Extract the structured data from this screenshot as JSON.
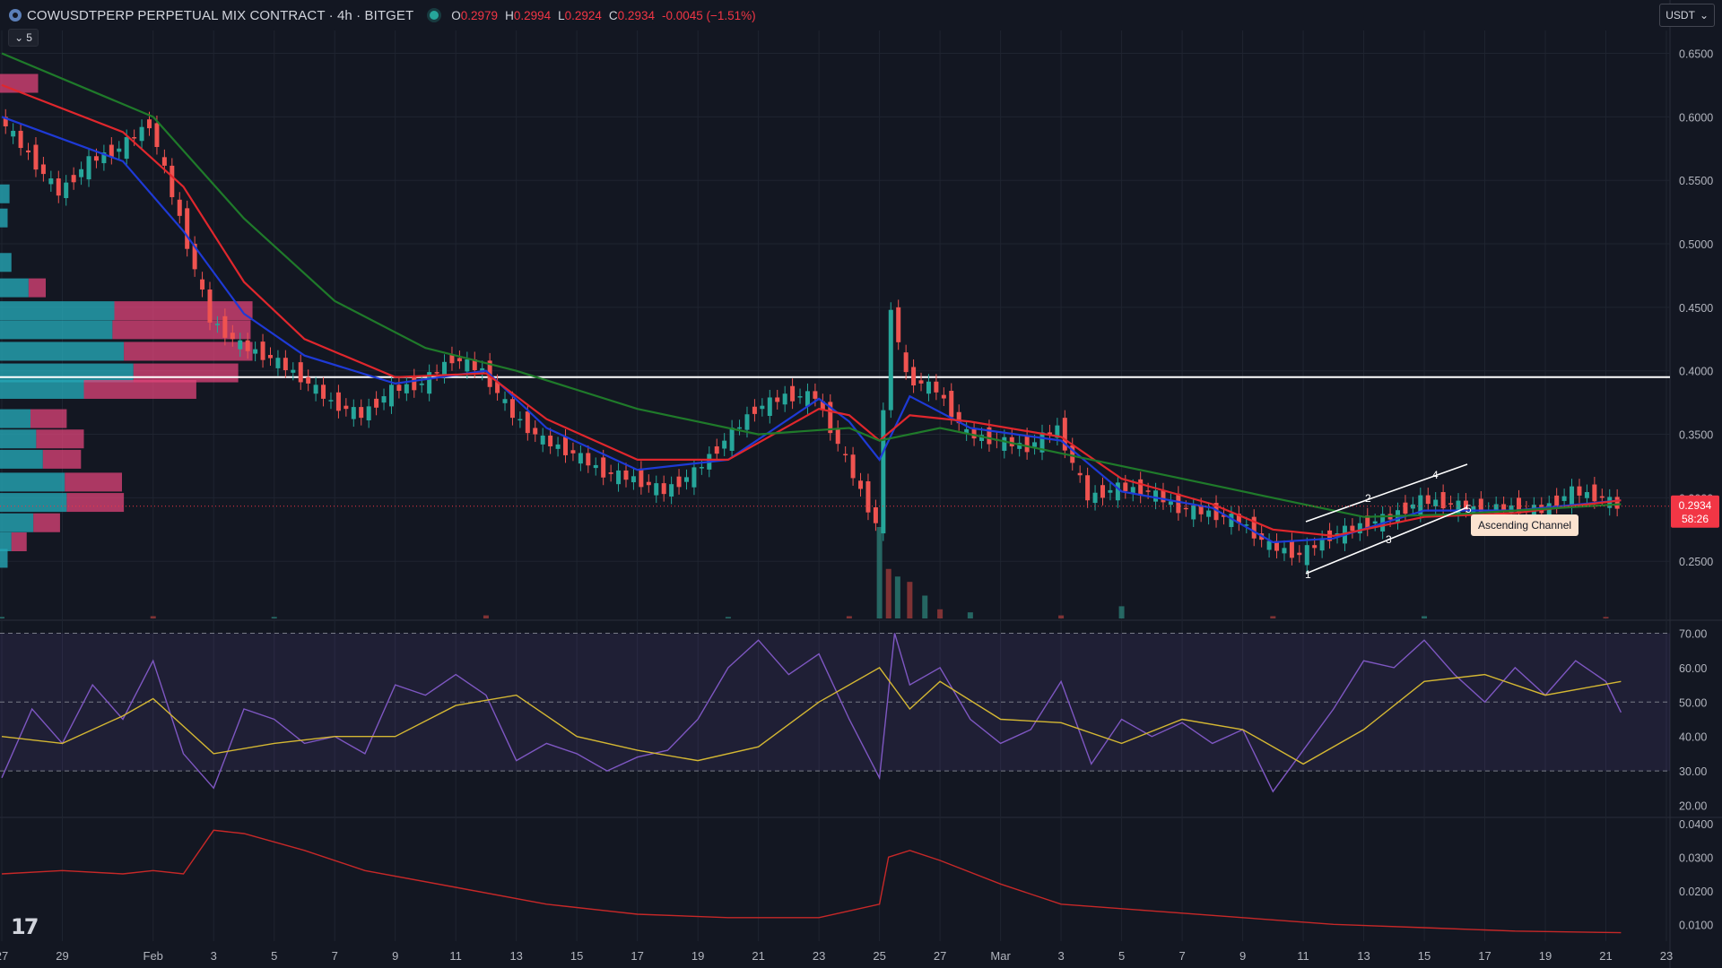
{
  "header": {
    "symbol_title": "COWUSDTPERP PERPETUAL MIX CONTRACT · 4h · BITGET",
    "ohlc": [
      {
        "k": "O",
        "v": "0.2979"
      },
      {
        "k": "H",
        "v": "0.2994"
      },
      {
        "k": "L",
        "v": "0.2924"
      },
      {
        "k": "C",
        "v": "0.2934"
      },
      {
        "k": "",
        "v": "-0.0045 (−1.51%)"
      }
    ],
    "indicator_collapse_count": "5",
    "currency": "USDT",
    "icons": {
      "symbol": "cow-coin-icon",
      "status": "live-status-dot",
      "collapse": "chevron-down-icon",
      "currency": "chevron-down-icon",
      "logo": "tradingview-logo"
    }
  },
  "logo_text": "17",
  "chart_data": {
    "type": "line",
    "price_axis": {
      "labels": [
        "0.6500",
        "0.6000",
        "0.5500",
        "0.5000",
        "0.4500",
        "0.4000",
        "0.3500",
        "0.3000",
        "0.2500"
      ],
      "values": [
        0.65,
        0.6,
        0.55,
        0.5,
        0.45,
        0.4,
        0.35,
        0.3,
        0.25
      ],
      "range": [
        0.205,
        0.668
      ]
    },
    "x_axis": {
      "ticks": [
        "27",
        "29",
        "Feb",
        "3",
        "5",
        "7",
        "9",
        "11",
        "13",
        "15",
        "17",
        "19",
        "21",
        "23",
        "25",
        "27",
        "Mar",
        "3",
        "5",
        "7",
        "9",
        "11",
        "13",
        "15",
        "17",
        "19",
        "21",
        "23"
      ],
      "dates": [
        "Jan 27",
        "Jan 29",
        "Feb 1",
        "Feb 3",
        "Feb 5",
        "Feb 7",
        "Feb 9",
        "Feb 11",
        "Feb 13",
        "Feb 15",
        "Feb 17",
        "Feb 19",
        "Feb 21",
        "Feb 23",
        "Feb 25",
        "Feb 27",
        "Mar 1",
        "Mar 3",
        "Mar 5",
        "Mar 7",
        "Mar 9",
        "Mar 11",
        "Mar 13",
        "Mar 15",
        "Mar 17",
        "Mar 19",
        "Mar 21",
        "Mar 23"
      ]
    },
    "price_series": {
      "name": "Price",
      "dates": [
        "Jan 27",
        "Jan 28",
        "Jan 29",
        "Jan 30",
        "Jan 31",
        "Feb 1",
        "Feb 2",
        "Feb 3",
        "Feb 4",
        "Feb 5",
        "Feb 6",
        "Feb 7",
        "Feb 8",
        "Feb 9",
        "Feb 10",
        "Feb 11",
        "Feb 12",
        "Feb 13",
        "Feb 14",
        "Feb 15",
        "Feb 16",
        "Feb 17",
        "Feb 18",
        "Feb 19",
        "Feb 20",
        "Feb 21",
        "Feb 22",
        "Feb 23",
        "Feb 24",
        "Feb 25",
        "Feb 25.5",
        "Feb 26",
        "Feb 27",
        "Feb 28",
        "Mar 1",
        "Mar 2",
        "Mar 3",
        "Mar 4",
        "Mar 5",
        "Mar 6",
        "Mar 7",
        "Mar 8",
        "Mar 9",
        "Mar 10",
        "Mar 11",
        "Mar 12",
        "Mar 13",
        "Mar 14",
        "Mar 15",
        "Mar 16",
        "Mar 17",
        "Mar 18",
        "Mar 19",
        "Mar 20",
        "Mar 21",
        "Mar 21.5"
      ],
      "values": [
        0.6,
        0.57,
        0.54,
        0.565,
        0.575,
        0.595,
        0.52,
        0.44,
        0.42,
        0.41,
        0.395,
        0.375,
        0.365,
        0.385,
        0.39,
        0.41,
        0.4,
        0.365,
        0.345,
        0.335,
        0.32,
        0.315,
        0.305,
        0.32,
        0.345,
        0.37,
        0.38,
        0.38,
        0.33,
        0.28,
        0.45,
        0.395,
        0.385,
        0.35,
        0.345,
        0.34,
        0.355,
        0.3,
        0.308,
        0.305,
        0.292,
        0.288,
        0.282,
        0.262,
        0.255,
        0.27,
        0.278,
        0.285,
        0.298,
        0.295,
        0.29,
        0.292,
        0.29,
        0.305,
        0.3,
        0.2934
      ]
    },
    "moving_averages": [
      {
        "color": "#1e3ad6",
        "dates": [
          "Jan 27",
          "Jan 31",
          "Feb 2",
          "Feb 4",
          "Feb 6",
          "Feb 9",
          "Feb 12",
          "Feb 14",
          "Feb 17",
          "Feb 20",
          "Feb 23",
          "Feb 24",
          "Feb 25",
          "Feb 26",
          "Feb 28",
          "Mar 3",
          "Mar 5",
          "Mar 8",
          "Mar 10",
          "Mar 12",
          "Mar 15",
          "Mar 18",
          "Mar 21.5"
        ],
        "values": [
          0.6,
          0.565,
          0.51,
          0.445,
          0.412,
          0.39,
          0.4,
          0.355,
          0.322,
          0.33,
          0.378,
          0.36,
          0.33,
          0.38,
          0.355,
          0.345,
          0.305,
          0.292,
          0.265,
          0.268,
          0.29,
          0.29,
          0.298
        ]
      },
      {
        "color": "#e0272d",
        "dates": [
          "Jan 27",
          "Jan 31",
          "Feb 2",
          "Feb 4",
          "Feb 6",
          "Feb 9",
          "Feb 12",
          "Feb 14",
          "Feb 17",
          "Feb 20",
          "Feb 23",
          "Feb 24",
          "Feb 25",
          "Feb 26",
          "Feb 28",
          "Mar 3",
          "Mar 5",
          "Mar 8",
          "Mar 10",
          "Mar 12",
          "Mar 15",
          "Mar 18",
          "Mar 21.5"
        ],
        "values": [
          0.625,
          0.588,
          0.545,
          0.47,
          0.425,
          0.395,
          0.398,
          0.362,
          0.33,
          0.33,
          0.37,
          0.365,
          0.345,
          0.365,
          0.36,
          0.348,
          0.315,
          0.295,
          0.275,
          0.27,
          0.285,
          0.288,
          0.298
        ]
      },
      {
        "color": "#1f7a2a",
        "dates": [
          "Jan 27",
          "Feb 1",
          "Feb 4",
          "Feb 7",
          "Feb 10",
          "Feb 13",
          "Feb 17",
          "Feb 21",
          "Feb 24",
          "Feb 25",
          "Feb 27",
          "Mar 1",
          "Mar 4",
          "Mar 7",
          "Mar 10",
          "Mar 13",
          "Mar 16",
          "Mar 21.5"
        ],
        "values": [
          0.65,
          0.6,
          0.52,
          0.455,
          0.418,
          0.4,
          0.37,
          0.35,
          0.355,
          0.345,
          0.355,
          0.345,
          0.33,
          0.315,
          0.3,
          0.285,
          0.287,
          0.295
        ]
      }
    ],
    "horizontal_line": {
      "value": 0.395,
      "color": "#ffffff"
    },
    "current_price": {
      "label": "0.2934",
      "countdown": "58:26",
      "value": 0.2934
    },
    "annotation": {
      "label": "Ascending Channel",
      "points": [
        "1",
        "2",
        "3",
        "4",
        "5"
      ]
    },
    "volume": {
      "dates": [
        "Jan 27",
        "Feb 1",
        "Feb 5",
        "Feb 12",
        "Feb 20",
        "Feb 24",
        "Feb 25",
        "Feb 25.3",
        "Feb 25.6",
        "Feb 26",
        "Feb 26.5",
        "Feb 27",
        "Feb 28",
        "Mar 3",
        "Mar 5",
        "Mar 10",
        "Mar 15",
        "Mar 21"
      ],
      "values": [
        2,
        3,
        2,
        4,
        2,
        3,
        120,
        65,
        55,
        48,
        30,
        12,
        8,
        4,
        16,
        3,
        3,
        2
      ]
    },
    "rsi": {
      "labels": [
        "70.00",
        "60.00",
        "50.00",
        "40.00",
        "30.00",
        "20.00"
      ],
      "values_axis": [
        70,
        60,
        50,
        40,
        30,
        20
      ],
      "range": [
        17,
        73
      ],
      "bands": [
        70,
        50,
        30
      ],
      "rsi_line": {
        "color": "#7e57c2",
        "dates": [
          "Jan 27",
          "Jan 28",
          "Jan 29",
          "Jan 30",
          "Jan 31",
          "Feb 1",
          "Feb 2",
          "Feb 3",
          "Feb 4",
          "Feb 5",
          "Feb 6",
          "Feb 7",
          "Feb 8",
          "Feb 9",
          "Feb 10",
          "Feb 11",
          "Feb 12",
          "Feb 13",
          "Feb 14",
          "Feb 15",
          "Feb 16",
          "Feb 17",
          "Feb 18",
          "Feb 19",
          "Feb 20",
          "Feb 21",
          "Feb 22",
          "Feb 23",
          "Feb 24",
          "Feb 25",
          "Feb 25.5",
          "Feb 26",
          "Feb 27",
          "Feb 28",
          "Mar 1",
          "Mar 2",
          "Mar 3",
          "Mar 4",
          "Mar 5",
          "Mar 6",
          "Mar 7",
          "Mar 8",
          "Mar 9",
          "Mar 10",
          "Mar 11",
          "Mar 12",
          "Mar 13",
          "Mar 14",
          "Mar 15",
          "Mar 16",
          "Mar 17",
          "Mar 18",
          "Mar 19",
          "Mar 20",
          "Mar 21",
          "Mar 21.5"
        ],
        "values": [
          28,
          48,
          38,
          55,
          45,
          62,
          35,
          25,
          48,
          45,
          38,
          40,
          35,
          55,
          52,
          58,
          52,
          33,
          38,
          35,
          30,
          34,
          36,
          45,
          60,
          68,
          58,
          64,
          45,
          28,
          70,
          55,
          60,
          45,
          38,
          42,
          56,
          32,
          45,
          40,
          44,
          38,
          42,
          24,
          36,
          48,
          62,
          60,
          68,
          58,
          50,
          60,
          52,
          62,
          56,
          47
        ]
      },
      "signal_line": {
        "color": "#d4b733",
        "dates": [
          "Jan 27",
          "Jan 29",
          "Jan 31",
          "Feb 1",
          "Feb 3",
          "Feb 5",
          "Feb 7",
          "Feb 9",
          "Feb 11",
          "Feb 13",
          "Feb 15",
          "Feb 17",
          "Feb 19",
          "Feb 21",
          "Feb 23",
          "Feb 25",
          "Feb 26",
          "Feb 27",
          "Mar 1",
          "Mar 3",
          "Mar 5",
          "Mar 7",
          "Mar 9",
          "Mar 11",
          "Mar 13",
          "Mar 15",
          "Mar 17",
          "Mar 19",
          "Mar 21.5"
        ],
        "values": [
          40,
          38,
          46,
          51,
          35,
          38,
          40,
          40,
          49,
          52,
          40,
          36,
          33,
          37,
          50,
          60,
          48,
          56,
          45,
          44,
          38,
          45,
          42,
          32,
          42,
          56,
          58,
          52,
          56
        ]
      }
    },
    "lower_indicator": {
      "labels": [
        "0.0400",
        "0.0300",
        "0.0200",
        "0.0100"
      ],
      "values_axis": [
        0.04,
        0.03,
        0.02,
        0.01
      ],
      "range": [
        0.005,
        0.041
      ],
      "line": {
        "color": "#c62828",
        "dates": [
          "Jan 27",
          "Jan 29",
          "Jan 31",
          "Feb 1",
          "Feb 2",
          "Feb 3",
          "Feb 4",
          "Feb 6",
          "Feb 8",
          "Feb 11",
          "Feb 14",
          "Feb 17",
          "Feb 20",
          "Feb 23",
          "Feb 25",
          "Feb 25.3",
          "Feb 26",
          "Feb 27",
          "Mar 1",
          "Mar 3",
          "Mar 6",
          "Mar 9",
          "Mar 12",
          "Mar 15",
          "Mar 18",
          "Mar 21.5"
        ],
        "values": [
          0.025,
          0.026,
          0.025,
          0.026,
          0.025,
          0.038,
          0.037,
          0.032,
          0.026,
          0.021,
          0.016,
          0.013,
          0.012,
          0.012,
          0.016,
          0.03,
          0.032,
          0.029,
          0.022,
          0.016,
          0.014,
          0.012,
          0.01,
          0.009,
          0.008,
          0.0075
        ]
      }
    },
    "volume_profile": {
      "rows": [
        {
          "price": 0.626,
          "buy": 0,
          "sell": 40
        },
        {
          "price": 0.539,
          "buy": 10,
          "sell": 0
        },
        {
          "price": 0.52,
          "buy": 8,
          "sell": 0
        },
        {
          "price": 0.485,
          "buy": 12,
          "sell": 0
        },
        {
          "price": 0.465,
          "buy": 30,
          "sell": 18
        },
        {
          "price": 0.447,
          "buy": 120,
          "sell": 145
        },
        {
          "price": 0.432,
          "buy": 118,
          "sell": 145
        },
        {
          "price": 0.415,
          "buy": 130,
          "sell": 135
        },
        {
          "price": 0.398,
          "buy": 140,
          "sell": 110
        },
        {
          "price": 0.385,
          "buy": 88,
          "sell": 118
        },
        {
          "price": 0.362,
          "buy": 32,
          "sell": 38
        },
        {
          "price": 0.346,
          "buy": 38,
          "sell": 50
        },
        {
          "price": 0.33,
          "buy": 45,
          "sell": 40
        },
        {
          "price": 0.312,
          "buy": 68,
          "sell": 60
        },
        {
          "price": 0.296,
          "buy": 70,
          "sell": 60
        },
        {
          "price": 0.28,
          "buy": 35,
          "sell": 28
        },
        {
          "price": 0.265,
          "buy": 12,
          "sell": 16
        },
        {
          "price": 0.252,
          "buy": 8,
          "sell": 0
        }
      ]
    },
    "colors": {
      "up": "#26a69a",
      "down": "#ef5350",
      "grid": "#1f2430",
      "background": "#131722",
      "price_tag": "#f23645"
    }
  }
}
